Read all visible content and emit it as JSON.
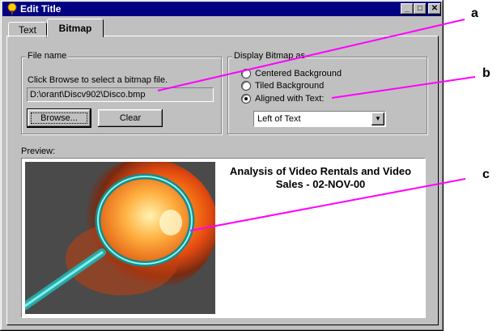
{
  "window": {
    "title": "Edit Title",
    "controls": {
      "minimize": "_",
      "maximize": "□",
      "close": "✕"
    }
  },
  "tabs": [
    {
      "label": "Text",
      "active": false
    },
    {
      "label": "Bitmap",
      "active": true
    }
  ],
  "file_group": {
    "label": "File name",
    "instruction": "Click Browse to select a bitmap file.",
    "path": "D:\\orant\\Discv902\\Disco.bmp",
    "browse_label": "Browse...",
    "clear_label": "Clear"
  },
  "display_group": {
    "label": "Display Bitmap as",
    "options": [
      {
        "label": "Centered Background",
        "selected": false
      },
      {
        "label": "Tiled Background",
        "selected": false
      },
      {
        "label": "Aligned with Text:",
        "selected": true
      }
    ],
    "alignment_value": "Left of Text"
  },
  "preview": {
    "label": "Preview:",
    "title_line1": "Analysis of Video Rentals and Video",
    "title_line2": "Sales  - 02-NOV-00"
  },
  "callouts": {
    "a": "a",
    "b": "b",
    "c": "c"
  },
  "colors": {
    "titlebar": "#000080",
    "face": "#c0c0c0",
    "callout_line": "#ff00ff"
  },
  "icons": [
    "app-icon",
    "minimize-icon",
    "maximize-icon",
    "close-icon",
    "dropdown-arrow-icon",
    "magnifier-bitmap"
  ]
}
